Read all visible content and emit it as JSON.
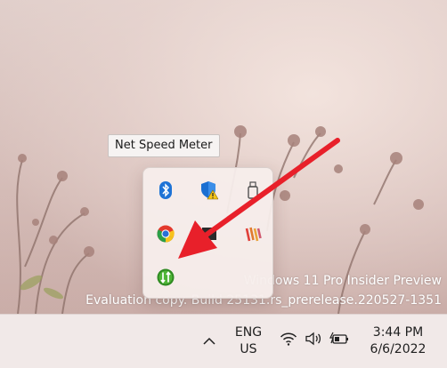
{
  "desktop": {
    "watermark_line1": "Windows 11 Pro Insider Preview",
    "watermark_line2": "Evaluation copy. Build 25131.rs_prerelease.220527-1351"
  },
  "tooltip": {
    "text": "Net Speed Meter"
  },
  "tray_overflow": {
    "icons": [
      {
        "name": "bluetooth-icon",
        "color": "#1e73d6"
      },
      {
        "name": "windows-security-warning-icon",
        "color": "#1b6fd1"
      },
      {
        "name": "usb-drive-icon",
        "color": "#505050"
      },
      {
        "name": "chrome-icon",
        "color": "#e3392c"
      },
      {
        "name": "dark-square-app-icon",
        "color": "#2a2a2a"
      },
      {
        "name": "striped-app-icon",
        "color": "#e07a2e"
      },
      {
        "name": "net-speed-meter-icon",
        "color": "#3a9a2a"
      }
    ]
  },
  "taskbar": {
    "language_line1": "ENG",
    "language_line2": "US",
    "time": "3:44 PM",
    "date": "6/6/2022"
  },
  "annotation": {
    "arrow_color": "#e8202a"
  }
}
